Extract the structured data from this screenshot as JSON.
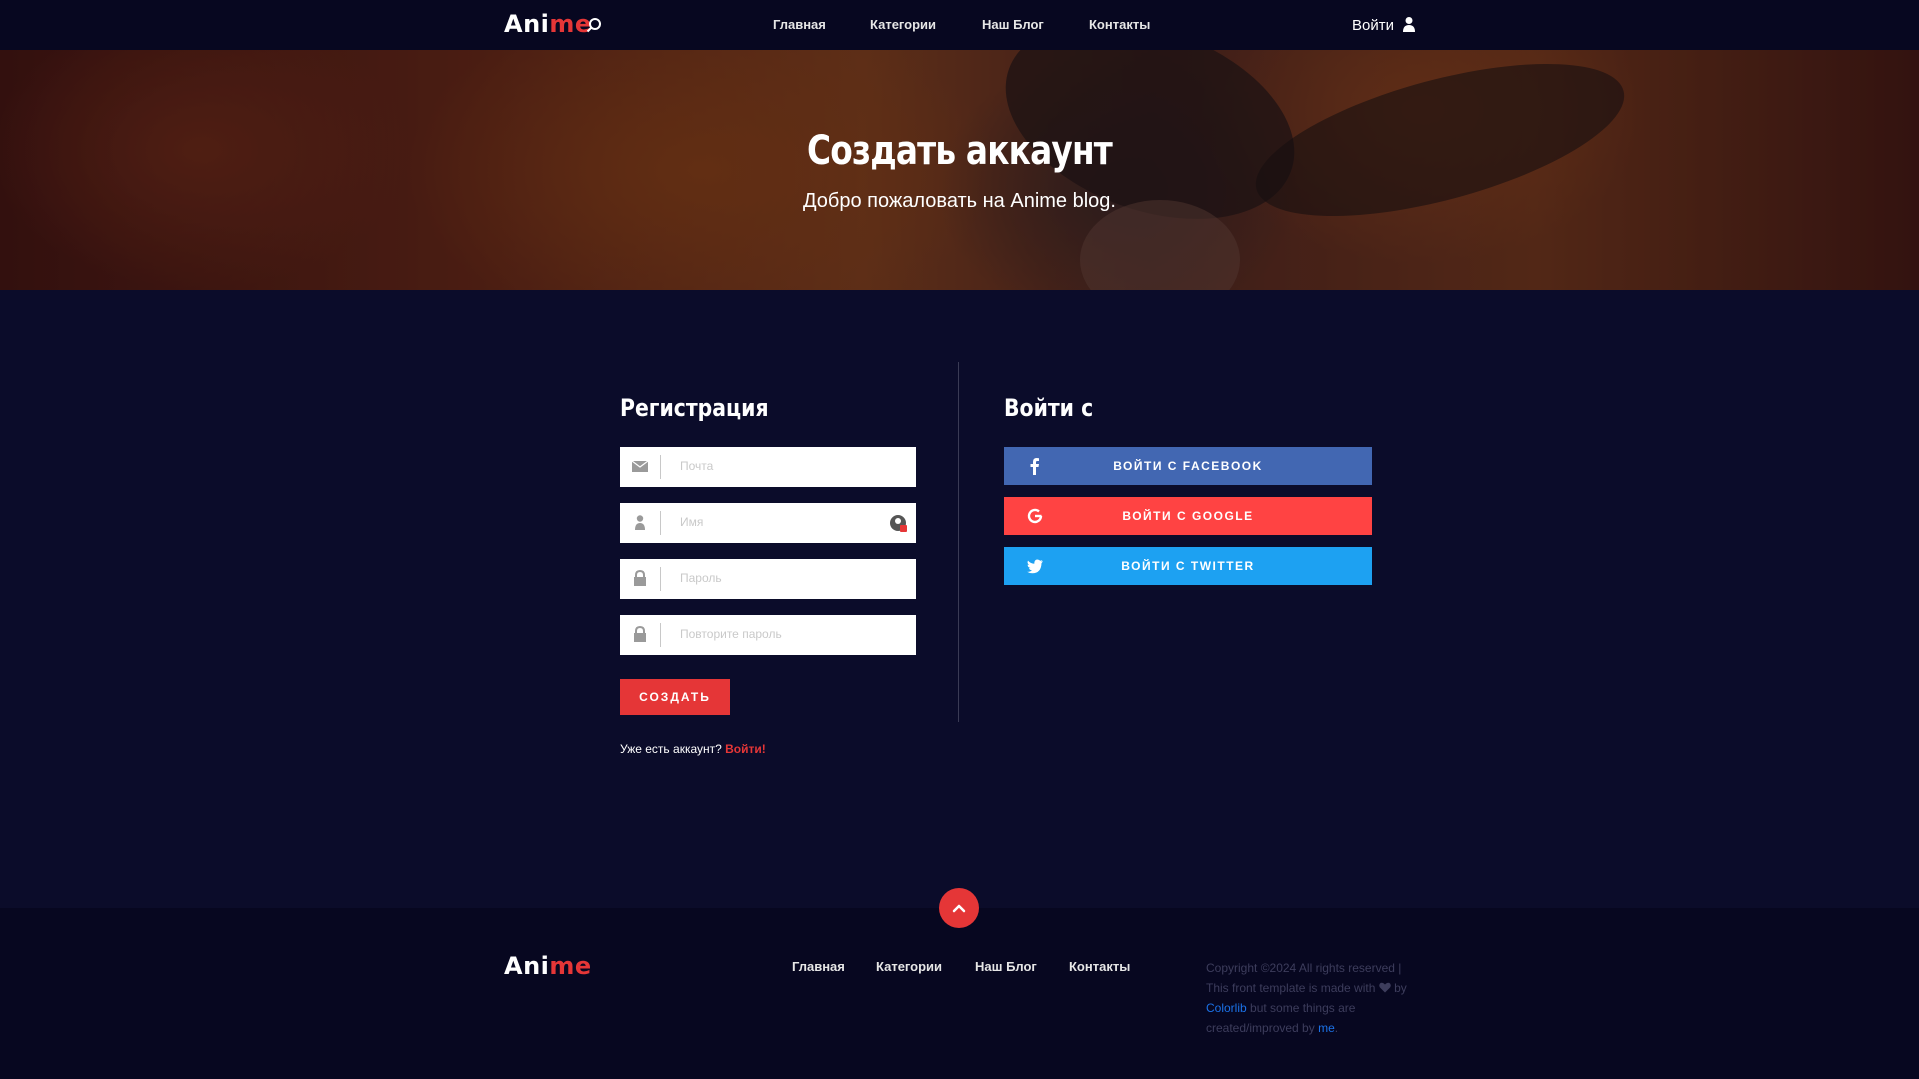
{
  "header": {
    "logo_part1": "Ani",
    "logo_part2": "me",
    "nav": [
      "Главная",
      "Категории",
      "Наш Блог",
      "Контакты"
    ],
    "login_label": "Войти"
  },
  "hero": {
    "title": "Создать аккаунт",
    "subtitle": "Добро пожаловать на Anime blog."
  },
  "register": {
    "title": "Регистрация",
    "fields": [
      {
        "placeholder": "Почта",
        "icon": "envelope-icon"
      },
      {
        "placeholder": "Имя",
        "icon": "user-icon"
      },
      {
        "placeholder": "Пароль",
        "icon": "lock-icon"
      },
      {
        "placeholder": "Повторите пароль",
        "icon": "lock-icon"
      }
    ],
    "submit_label": "СОЗДАТЬ",
    "already_text": "Уже есть аккаунт?",
    "login_link": "Войти!"
  },
  "login_with": {
    "title": "Войти с",
    "buttons": [
      {
        "label": "ВОЙТИ С FACEBOOK",
        "color": "#4267b2",
        "icon": "facebook-icon"
      },
      {
        "label": "ВОЙТИ С GOOGLE",
        "color": "#ff4343",
        "icon": "google-icon"
      },
      {
        "label": "ВОЙТИ С TWITTER",
        "color": "#1da1f2",
        "icon": "twitter-icon"
      }
    ]
  },
  "footer": {
    "logo_part1": "Ani",
    "logo_part2": "me",
    "nav": [
      "Главная",
      "Категории",
      "Наш Блог",
      "Контакты"
    ],
    "copyright_1": "Copyright ©2024 All rights reserved | This front template is made with",
    "copyright_2": "by",
    "colorlib": "Colorlib",
    "copyright_3": "but some things are created/improved by",
    "me": "me",
    "copyright_4": "."
  },
  "colors": {
    "accent": "#e53637",
    "background": "#0b0c2a",
    "header": "#070720"
  }
}
